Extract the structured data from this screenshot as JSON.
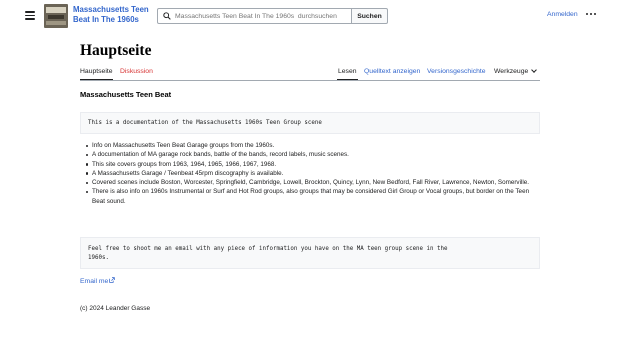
{
  "header": {
    "site_title": "Massachusetts Teen Beat In The 1960s",
    "search_placeholder": "Massachusetts Teen Beat In The 1960s  durchsuchen",
    "search_button": "Suchen",
    "login": "Anmelden",
    "menu_icon": "hamburger-menu-icon",
    "more_icon": "ellipsis-icon"
  },
  "page": {
    "title": "Hauptseite",
    "tabs_left": [
      "Hauptseite",
      "Diskussion"
    ],
    "tabs_right": [
      "Lesen",
      "Quelltext anzeigen",
      "Versionsgeschichte",
      "Werkzeuge"
    ]
  },
  "content": {
    "heading": "Massachusetts Teen Beat",
    "pre1": "This is a documentation of the Massachusetts 1960s Teen Group scene",
    "bullets": [
      "Info on Massachusetts Teen Beat Garage groups from the 1960s.",
      "A documentation of MA garage rock bands, battle of the bands, record labels, music scenes.",
      "This site covers groups from 1963, 1964, 1965, 1966, 1967, 1968.",
      "A Massachusetts Garage / Teenbeat 45rpm discography is available.",
      "Covered scenes include Boston, Worcester, Springfield, Cambridge, Lowell, Brockton, Quincy, Lynn, New Bedford, Fall River, Lawrence, Newton, Somerville.",
      "There is also info on 1960s Instrumental or Surf and Hot Rod groups, also groups that may be considered Girl Group or Vocal groups, but border on the Teen Beat sound."
    ],
    "pre2_line1": "Feel free to shoot me an email with any piece of information you have on the MA teen group scene in the",
    "pre2_line2": "1960s.",
    "email_link": "Email me",
    "copyright": "(c) 2024 Leander Gasse"
  },
  "colors": {
    "link": "#3366cc",
    "new_link": "#d73333",
    "text": "#202122"
  }
}
